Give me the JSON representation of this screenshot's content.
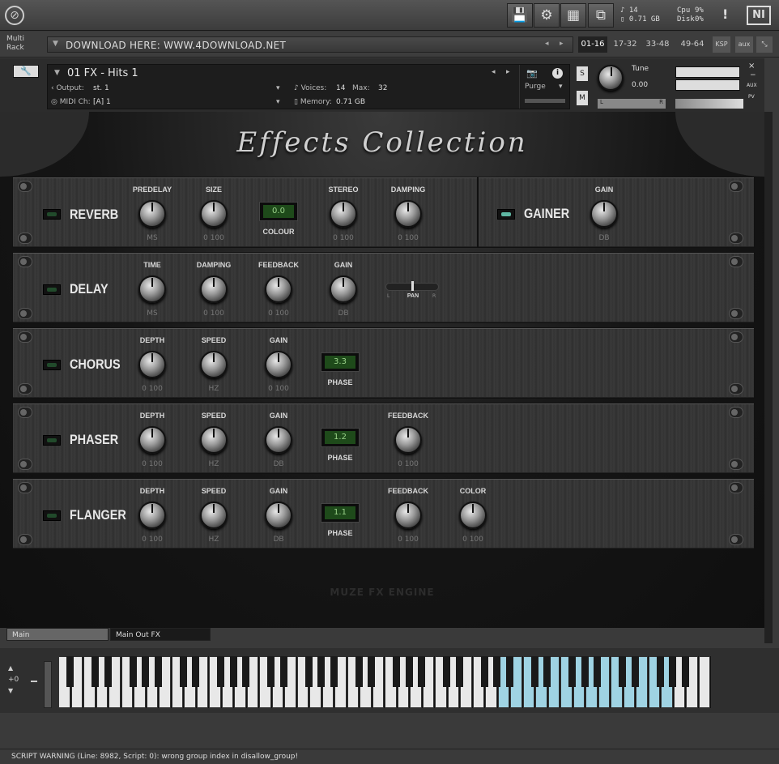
{
  "topbar": {
    "save_icon": "💾",
    "gear_icon": "⚙",
    "view_icon": "▦",
    "resize_icon": "⧉",
    "voices": "14",
    "memory": "0.71 GB",
    "cpu_label": "Cpu",
    "cpu": "9%",
    "disk_label": "Disk",
    "disk": "0%",
    "warn": "!",
    "ni_logo": "NI"
  },
  "rack": {
    "label": "Multi Rack",
    "download": "DOWNLOAD HERE: WWW.4DOWNLOAD.NET",
    "pages": [
      "01-16",
      "17-32",
      "33-48",
      "49-64"
    ],
    "ksp": "KSP",
    "aux": "aux"
  },
  "instrument": {
    "title": "01 FX - Hits 1",
    "output_label": "Output:",
    "output": "st. 1",
    "midi_label": "MIDI Ch:",
    "midi": "[A]  1",
    "voices_label": "Voices:",
    "voices": "14",
    "max_label": "Max:",
    "max": "32",
    "memory_label": "Memory:",
    "memory": "0.71 GB",
    "purge": "Purge",
    "tune_label": "Tune",
    "tune": "0.00",
    "s": "S",
    "m": "M",
    "l": "L",
    "r": "R",
    "aux": "AUX",
    "pv": "PV",
    "plus": "+",
    "minus": "−"
  },
  "title": "Effects Collection",
  "fx": {
    "reverb": {
      "name": "REVERB",
      "predelay": "PREDELAY",
      "ms": "MS",
      "size": "SIZE",
      "range": "0  100",
      "colour": "COLOUR",
      "colour_val": "0.0",
      "stereo": "STEREO",
      "damping": "DAMPING"
    },
    "gainer": {
      "name": "GAINER",
      "gain": "GAIN",
      "db": "DB"
    },
    "delay": {
      "name": "DELAY",
      "time": "TIME",
      "ms": "MS",
      "damping": "DAMPING",
      "range": "0  100",
      "feedback": "FEEDBACK",
      "gain": "GAIN",
      "db": "DB",
      "pan": "PAN",
      "l": "L",
      "r": "R"
    },
    "chorus": {
      "name": "CHORUS",
      "depth": "DEPTH",
      "range": "0  100",
      "speed": "SPEED",
      "hz": "HZ",
      "gain": "GAIN",
      "phase": "PHASE",
      "phase_val": "3.3"
    },
    "phaser": {
      "name": "PHASER",
      "depth": "DEPTH",
      "range": "0  100",
      "speed": "SPEED",
      "hz": "HZ",
      "gain": "GAIN",
      "db": "DB",
      "phase": "PHASE",
      "phase_val": "1.2",
      "feedback": "FEEDBACK"
    },
    "flanger": {
      "name": "FLANGER",
      "depth": "DEPTH",
      "range": "0  100",
      "speed": "SPEED",
      "hz": "HZ",
      "gain": "GAIN",
      "db": "DB",
      "phase": "PHASE",
      "phase_val": "1.1",
      "feedback": "FEEDBACK",
      "color": "COLOR"
    }
  },
  "engine": "MUZE FX ENGINE",
  "tabs": [
    "Main",
    "Main Out FX"
  ],
  "keyboard": {
    "octave": "+0"
  },
  "status": "SCRIPT WARNING (Line: 8982, Script: 0):   wrong group index in disallow_group!"
}
